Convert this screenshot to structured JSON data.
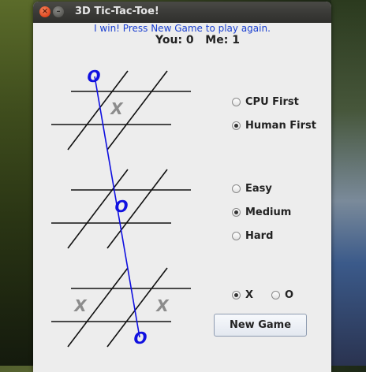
{
  "window": {
    "title": "3D Tic-Tac-Toe!",
    "close_glyph": "×",
    "minimize_glyph": "–"
  },
  "status_message": "I win! Press New Game to play again.",
  "score": {
    "you_label": "You:",
    "you_value": "0",
    "me_label": "Me:",
    "me_value": "1"
  },
  "board": {
    "marks": [
      {
        "label": "X",
        "color": "#8c8c8c"
      },
      {
        "label": "O",
        "color": "#1010e0"
      },
      {
        "label": "O",
        "color": "#1010e0"
      },
      {
        "label": "X",
        "color": "#8c8c8c"
      },
      {
        "label": "X",
        "color": "#8c8c8c"
      },
      {
        "label": "O",
        "color": "#1010e0"
      }
    ],
    "win_line_color": "#1010e0"
  },
  "first_player": {
    "options": [
      "CPU First",
      "Human First"
    ],
    "selected": "Human First"
  },
  "difficulty": {
    "options": [
      "Easy",
      "Medium",
      "Hard"
    ],
    "selected": "Medium"
  },
  "symbol": {
    "options": [
      "X",
      "O"
    ],
    "selected": "X"
  },
  "buttons": {
    "new_game": "New Game"
  }
}
